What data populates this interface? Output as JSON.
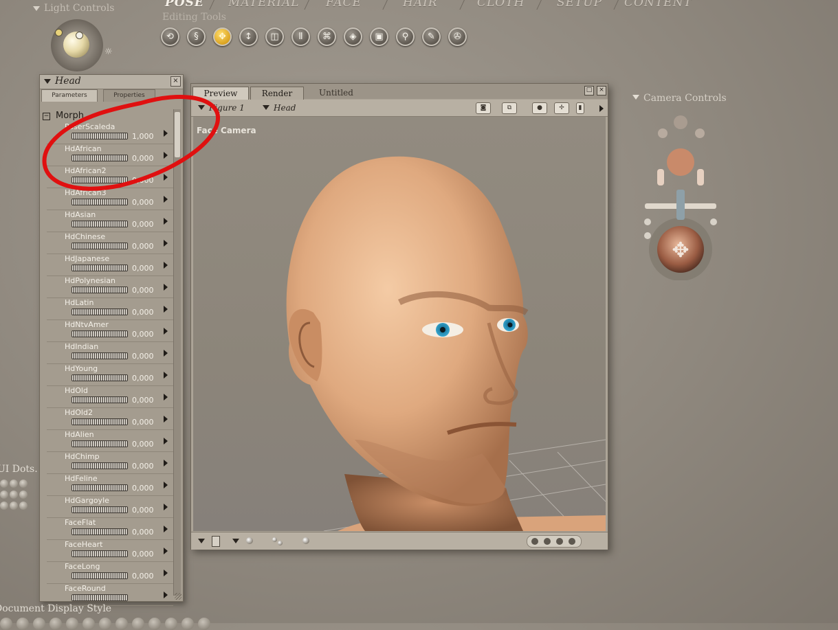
{
  "top_tabs": [
    "POSE",
    "MATERIAL",
    "FACE",
    "HAIR",
    "CLOTH",
    "SETUP",
    "CONTENT"
  ],
  "active_tab": "POSE",
  "editing_tools_label": "Editing Tools",
  "light_controls_label": "Light Controls",
  "tools": [
    "rotate-icon",
    "twist-icon",
    "translate-icon",
    "translate-in-out-icon",
    "scale-icon",
    "taper-icon",
    "chain-break-icon",
    "color-icon",
    "grouping-icon",
    "view-magnifier-icon",
    "morphing-tool-icon",
    "direct-manipulation-icon"
  ],
  "active_tool": "translate-icon",
  "param_panel": {
    "title": "Head",
    "tabs": [
      "Parameters",
      "Properties"
    ],
    "group": "Morph",
    "params": [
      {
        "name": "PoserScaleda",
        "value": "1,000"
      },
      {
        "name": "HdAfrican",
        "value": "0,000"
      },
      {
        "name": "HdAfrican2",
        "value": "0,000"
      },
      {
        "name": "HdAfrican3",
        "value": "0,000"
      },
      {
        "name": "HdAsian",
        "value": "0,000"
      },
      {
        "name": "HdChinese",
        "value": "0,000"
      },
      {
        "name": "HdJapanese",
        "value": "0,000"
      },
      {
        "name": "HdPolynesian",
        "value": "0,000"
      },
      {
        "name": "HdLatin",
        "value": "0,000"
      },
      {
        "name": "HdNtvAmer",
        "value": "0,000"
      },
      {
        "name": "HdIndian",
        "value": "0,000"
      },
      {
        "name": "HdYoung",
        "value": "0,000"
      },
      {
        "name": "HdOld",
        "value": "0,000"
      },
      {
        "name": "HdOld2",
        "value": "0,000"
      },
      {
        "name": "HdAlien",
        "value": "0,000"
      },
      {
        "name": "HdChimp",
        "value": "0,000"
      },
      {
        "name": "HdFeline",
        "value": "0,000"
      },
      {
        "name": "HdGargoyle",
        "value": "0,000"
      },
      {
        "name": "FaceFlat",
        "value": "0,000"
      },
      {
        "name": "FaceHeart",
        "value": "0,000"
      },
      {
        "name": "FaceLong",
        "value": "0,000"
      },
      {
        "name": "FaceRound",
        "value": ""
      }
    ]
  },
  "document": {
    "tabs": [
      "Preview",
      "Render",
      "Untitled"
    ],
    "figure_select": "Figure 1",
    "part_select": "Head",
    "camera_label": "Face Camera"
  },
  "camera_controls_label": "Camera Controls",
  "ui_dots_label": "UI Dots.",
  "doc_style_label": "Document Display Style",
  "colors": {
    "skin": "#e6b48c",
    "iris": "#2a8fb5",
    "annotation": "#e01010",
    "tool_active": "#e0a51e"
  }
}
